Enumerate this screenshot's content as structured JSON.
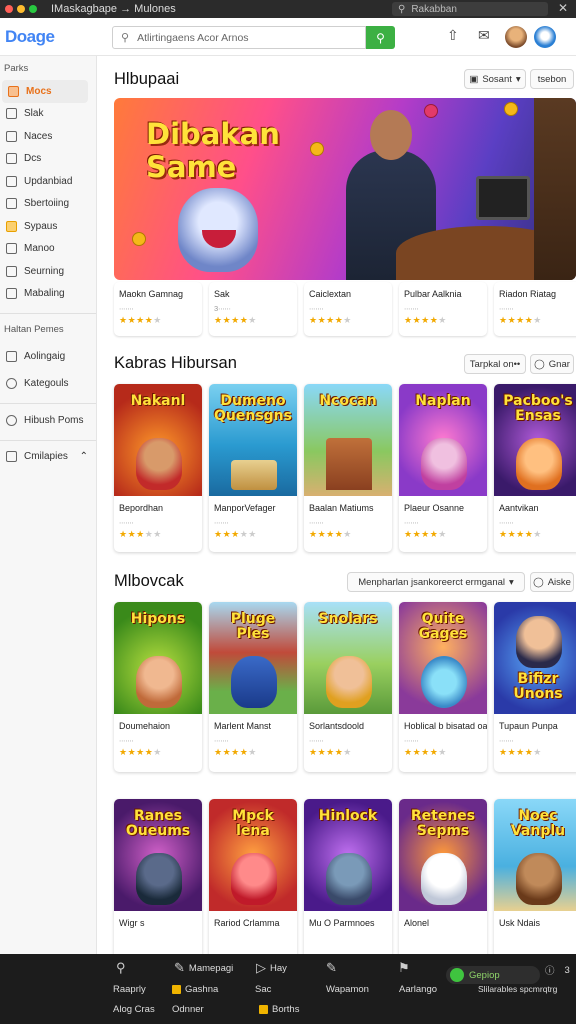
{
  "window": {
    "title": "IMaskagbape → Mulones",
    "search": "Rakabban"
  },
  "header": {
    "logo": "Doage",
    "search_placeholder": "Atlirtingaens Acor Arnos"
  },
  "sidebar": {
    "heading": "Parks",
    "items": [
      {
        "label": "Mocs",
        "active": true
      },
      {
        "label": "Slak"
      },
      {
        "label": "Naces"
      },
      {
        "label": "Dcs"
      },
      {
        "label": "Updanbiad"
      },
      {
        "label": "Sbertoiing"
      },
      {
        "label": "Sypaus"
      },
      {
        "label": "Manoo"
      },
      {
        "label": "Seurning"
      },
      {
        "label": "Mabaling"
      }
    ],
    "section2": "Haltan Pemes",
    "items2": [
      {
        "label": "Aolingaig"
      },
      {
        "label": "Kategouls"
      }
    ],
    "item3": "Hibush Poms",
    "item4": "Cmilapies"
  },
  "section1": {
    "title": "Hlbupaai",
    "sort_label": "Sosant",
    "filter_label": "tsebon",
    "hero_title": "Dibakan Same",
    "cards": [
      {
        "title": "Maokn Gamnag",
        "meta": "∙∙∙∙∙∙∙",
        "rating": 4
      },
      {
        "title": "Sak",
        "meta": "3∙∙∙∙∙∙",
        "rating": 4
      },
      {
        "title": "Caiclextan",
        "meta": "∙∙∙∙∙∙∙",
        "rating": 4
      },
      {
        "title": "Pulbar Aalknia",
        "meta": "∙∙∙∙∙∙∙",
        "rating": 4
      },
      {
        "title": "Riadon Riatag",
        "meta": "∙∙∙∙∙∙∙",
        "rating": 4
      }
    ]
  },
  "section2": {
    "title": "Kabras Hibursan",
    "sort_label": "Tarpkal on••",
    "filter_label": "Gnar",
    "cards": [
      {
        "title": "Bepordhan",
        "thumb_text": "Nakanl",
        "meta": "∙∙∙∙∙∙∙",
        "rating": 3
      },
      {
        "title": "ManporVefager",
        "thumb_text": "Dumeno Quensgns",
        "meta": "∙∙∙∙∙∙∙",
        "rating": 3
      },
      {
        "title": "Baalan Matiums",
        "thumb_text": "Ncocan",
        "meta": "∙∙∙∙∙∙∙",
        "rating": 4
      },
      {
        "title": "Plaeur Osanne",
        "thumb_text": "Naplan",
        "meta": "∙∙∙∙∙∙∙",
        "rating": 4
      },
      {
        "title": "Aantvikan",
        "thumb_text": "Pacboo's Ensas",
        "meta": "∙∙∙∙∙∙∙",
        "rating": 4
      }
    ]
  },
  "section3": {
    "title": "Mlbovcak",
    "sort_label": "Menpharlan jsankoreerct ermganal",
    "filter_label": "Aiske",
    "cards": [
      {
        "title": "Doumehaion",
        "thumb_text": "Hipons",
        "meta": "∙∙∙∙∙∙∙",
        "rating": 4
      },
      {
        "title": "Marlent Manst",
        "thumb_text": "Pluge Ples",
        "meta": "∙∙∙∙∙∙∙",
        "rating": 4
      },
      {
        "title": "Sorlantsdoold",
        "thumb_text": "Snolars",
        "meta": "∙∙∙∙∙∙∙",
        "rating": 4
      },
      {
        "title": "Hoblical b bisatad oangn",
        "thumb_text": "Quite Gages",
        "meta": "∙∙∙∙∙∙∙",
        "rating": 4
      },
      {
        "title": "Tupaun Punpa",
        "thumb_text": "Bifizr Unons",
        "meta": "∙∙∙∙∙∙∙",
        "rating": 4
      }
    ]
  },
  "section4": {
    "cards": [
      {
        "title": "Wigr s",
        "thumb_text": "Ranes Oueums"
      },
      {
        "title": "Rariod Crlamma",
        "thumb_text": "Mpck lena"
      },
      {
        "title": "Mu O Parmnoes",
        "thumb_text": "Hinlock"
      },
      {
        "title": "Alonel",
        "thumb_text": "Retenes Sepms"
      },
      {
        "title": "Usk Ndais",
        "thumb_text": "Noec Vanplu"
      }
    ]
  },
  "bottom_bar": {
    "row1": [
      "Mamepagi",
      "Hay",
      "Wapamon",
      "Aarlanjs"
    ],
    "pill_label": "Gepiop",
    "count": "3",
    "row2": [
      "Raaprly",
      "Gashna",
      "Sac",
      "Wapamon",
      "Aarlango",
      "Slilarables spcmrqtrg"
    ],
    "row3": [
      "Alog Cras",
      "Odnner",
      "Borths"
    ]
  },
  "colors": {
    "accent": "#e8711a",
    "search_button": "#3cb043",
    "star": "#f2a900"
  }
}
